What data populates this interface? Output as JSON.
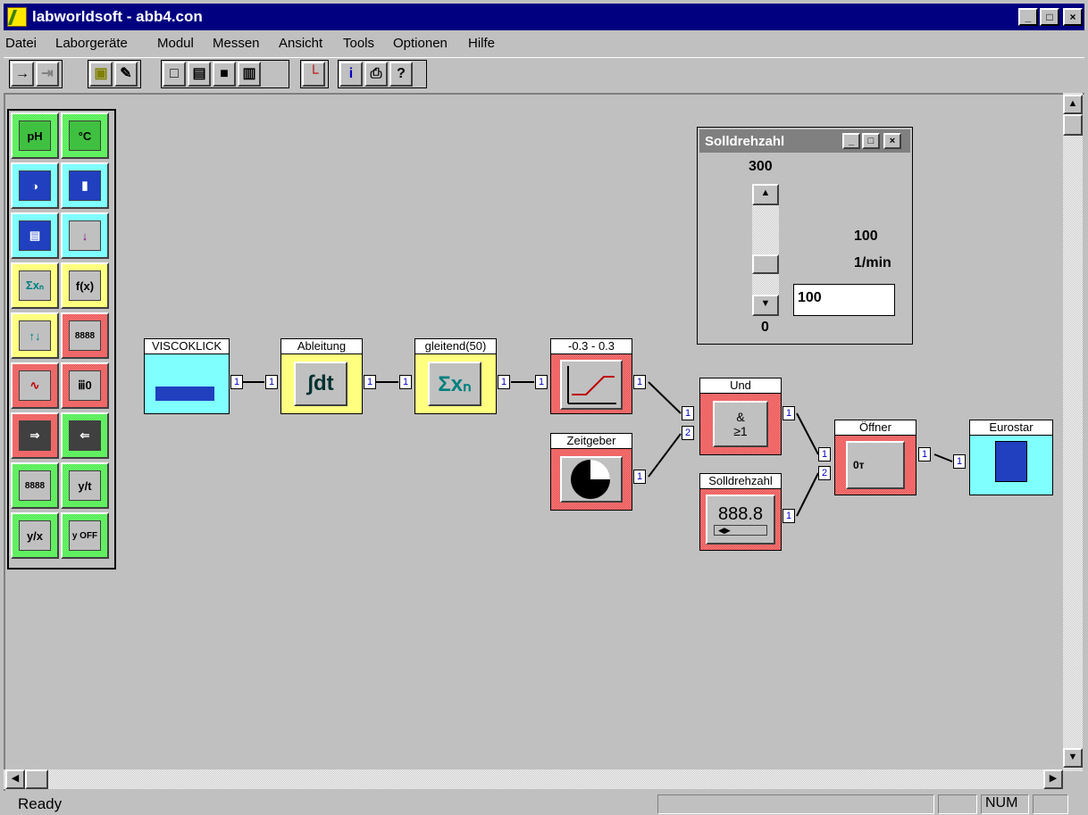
{
  "window": {
    "app": "labworldsoft",
    "title": "labworldsoft -  abb4.con",
    "min": "_",
    "max": "□",
    "close": "×"
  },
  "menu": [
    "Datei",
    "Laborgeräte",
    "Modul",
    "Messen",
    "Ansicht",
    "Tools",
    "Optionen",
    "Hilfe"
  ],
  "toolbar": {
    "run": "→",
    "step": "⇥",
    "module": "▣",
    "probe": "✎",
    "new": "□",
    "open": "▤",
    "save": "■",
    "find": "▥",
    "chart": "└",
    "info": "i",
    "print": "⎙",
    "help": "?"
  },
  "palette": [
    "pH",
    "°C",
    "◑",
    "▮",
    "▤",
    "↓",
    "Σxₙ",
    "f(x)",
    "↑↓",
    "8888",
    "∿",
    "ⅲ0",
    "⇒",
    "⇐",
    "8888",
    "y/t",
    "y/x",
    "y OFF"
  ],
  "blocks": {
    "viscoklick": {
      "label": "VISCOKLICK",
      "port_out": "1"
    },
    "ableitung": {
      "label": "Ableitung",
      "face": "∫dt",
      "port_in": "1",
      "port_out": "1"
    },
    "gleitend": {
      "label": "gleitend(50)",
      "face": "Σxₙ",
      "port_in": "1",
      "port_out": "1"
    },
    "range": {
      "label": "-0.3 - 0.3",
      "port_in": "1",
      "port_out": "1"
    },
    "zeitgeber": {
      "label": "Zeitgeber",
      "port_out": "1"
    },
    "und": {
      "label": "Und",
      "face_top": "&",
      "face_bottom": "≥1",
      "port_in1": "1",
      "port_in2": "2",
      "port_out": "1"
    },
    "solldrehzahl": {
      "label": "Solldrehzahl",
      "display": "888.8",
      "port_out": "1"
    },
    "oeffner": {
      "label": "Öffner",
      "face": "0т",
      "port_in1": "1",
      "port_in2": "2",
      "port_out": "1"
    },
    "eurostar": {
      "label": "Eurostar",
      "port_in": "1"
    }
  },
  "solldrehzahl_window": {
    "title": "Solldrehzahl",
    "max_label": "300",
    "min_label": "0",
    "value": "100",
    "unit": "1/min",
    "input_value": "100",
    "slider_level": 0.333
  },
  "status": {
    "ready": "Ready",
    "num": "NUM"
  },
  "colors": {
    "title": "#000080",
    "pink": "#ff8080",
    "yellow": "#ffff80",
    "cyan": "#80ffff",
    "green": "#80ff80"
  }
}
